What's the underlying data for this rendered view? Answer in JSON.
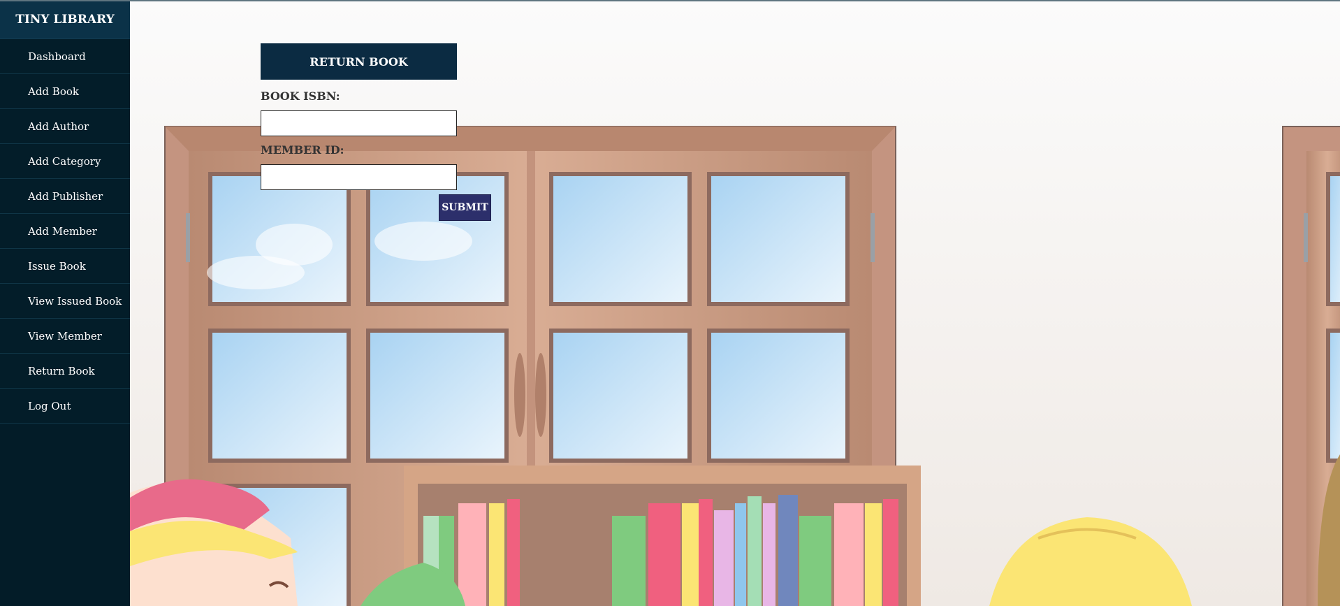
{
  "sidebar": {
    "brand": "TINY LIBRARY",
    "items": [
      {
        "label": "Dashboard"
      },
      {
        "label": "Add Book"
      },
      {
        "label": "Add Author"
      },
      {
        "label": "Add Category"
      },
      {
        "label": "Add Publisher"
      },
      {
        "label": "Add Member"
      },
      {
        "label": "Issue Book"
      },
      {
        "label": "View Issued Book"
      },
      {
        "label": "View Member"
      },
      {
        "label": "Return Book"
      },
      {
        "label": "Log Out"
      }
    ]
  },
  "form": {
    "title": "RETURN BOOK",
    "isbn_label": "BOOK ISBN:",
    "isbn_value": "",
    "member_label": "MEMBER ID:",
    "member_value": "",
    "submit_label": "SUBMIT"
  },
  "colors": {
    "sidebar_bg": "#031c28",
    "brand_bg": "#0b3248",
    "form_title_bg": "#0b2b42",
    "submit_bg": "#2c2f6b"
  }
}
